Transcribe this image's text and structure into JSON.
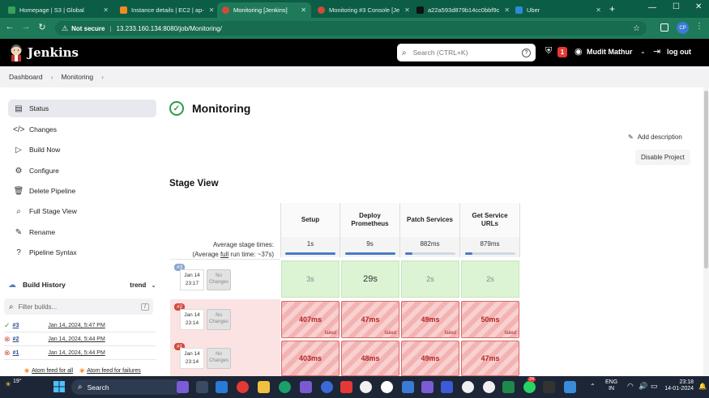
{
  "browser": {
    "tabs": [
      {
        "title": "Homepage | S3 | Global",
        "color": "#3aa15a",
        "active": false
      },
      {
        "title": "Instance details | EC2 | ap-",
        "color": "#f08a24",
        "active": false
      },
      {
        "title": "Monitoring [Jenkins]",
        "color": "#d24a3c",
        "active": true
      },
      {
        "title": "Monitoring #3 Console [Je",
        "color": "#d24a3c",
        "active": false
      },
      {
        "title": "a22a593d879b14cc0bbf9c",
        "color": "#111111",
        "active": false
      },
      {
        "title": "Uber",
        "color": "#2b8bd6",
        "active": false
      }
    ],
    "not_secure": "Not secure",
    "url": "13.233.160.134:8080/job/Monitoring/",
    "profile": "CP"
  },
  "jenkins": {
    "brand": "Jenkins",
    "search_placeholder": "Search (CTRL+K)",
    "notif_count": "1",
    "user": "Mudit Mathur",
    "logout": "log out"
  },
  "breadcrumb": [
    "Dashboard",
    "Monitoring"
  ],
  "sidebar": {
    "items": [
      {
        "label": "Status",
        "icon": "status-icon",
        "active": true
      },
      {
        "label": "Changes",
        "icon": "code-icon",
        "active": false
      },
      {
        "label": "Build Now",
        "icon": "play-icon",
        "active": false
      },
      {
        "label": "Configure",
        "icon": "gear-icon",
        "active": false
      },
      {
        "label": "Delete Pipeline",
        "icon": "trash-icon",
        "active": false
      },
      {
        "label": "Full Stage View",
        "icon": "search-icon",
        "active": false
      },
      {
        "label": "Rename",
        "icon": "pencil-icon",
        "active": false
      },
      {
        "label": "Pipeline Syntax",
        "icon": "help-icon",
        "active": false
      }
    ],
    "build_history": {
      "title": "Build History",
      "trend": "trend",
      "filter_placeholder": "Filter builds...",
      "filter_shortcut": "/",
      "builds": [
        {
          "num": "#3",
          "date": "Jan 14, 2024, 5:47 PM",
          "status": "success"
        },
        {
          "num": "#2",
          "date": "Jan 14, 2024, 5:44 PM",
          "status": "failed"
        },
        {
          "num": "#1",
          "date": "Jan 14, 2024, 5:44 PM",
          "status": "failed"
        }
      ],
      "atom_all": "Atom feed for all",
      "atom_failures": "Atom feed for failures"
    }
  },
  "main": {
    "title": "Monitoring",
    "add_description": "Add description",
    "disable_project": "Disable Project",
    "stage_view_title": "Stage View",
    "avg_label": "Average stage times:",
    "avg_full_prefix": "(Average ",
    "avg_full_word": "full",
    "avg_full_suffix": " run time: ~37s)",
    "stages": [
      {
        "name": "Setup",
        "avg": "1s",
        "bar": 1.0
      },
      {
        "name": "Deploy Prometheus",
        "avg": "9s",
        "bar": 1.0
      },
      {
        "name": "Patch Services",
        "avg": "882ms",
        "bar": 0.15
      },
      {
        "name": "Get Service URLs",
        "avg": "879ms",
        "bar": 0.15
      }
    ],
    "no_changes": "No Changes",
    "runs": [
      {
        "badge": "#3",
        "date": "Jan 14",
        "time": "23:17",
        "status": "success",
        "cells": [
          "3s",
          "29s",
          "2s",
          "2s"
        ]
      },
      {
        "badge": "#2",
        "date": "Jan 14",
        "time": "23:14",
        "status": "failed",
        "cells": [
          "407ms",
          "47ms",
          "49ms",
          "50ms"
        ]
      },
      {
        "badge": "#1",
        "date": "Jan 14",
        "time": "23:14",
        "status": "failed",
        "cells": [
          "403ms",
          "48ms",
          "49ms",
          "47ms"
        ]
      }
    ],
    "failed_label": "failed"
  },
  "taskbar": {
    "weather": "19°",
    "search": "Search",
    "lang": "ENG",
    "region": "IN",
    "time": "23:18",
    "date": "14-01-2024",
    "badge_count": "24"
  },
  "colors": {
    "chrome_dark": "#0b5d45",
    "chrome": "#1f7a5a",
    "jenkins_header": "#000000",
    "success": "#2e9b46",
    "failed": "#d24a3c",
    "notif": "#e53935"
  }
}
